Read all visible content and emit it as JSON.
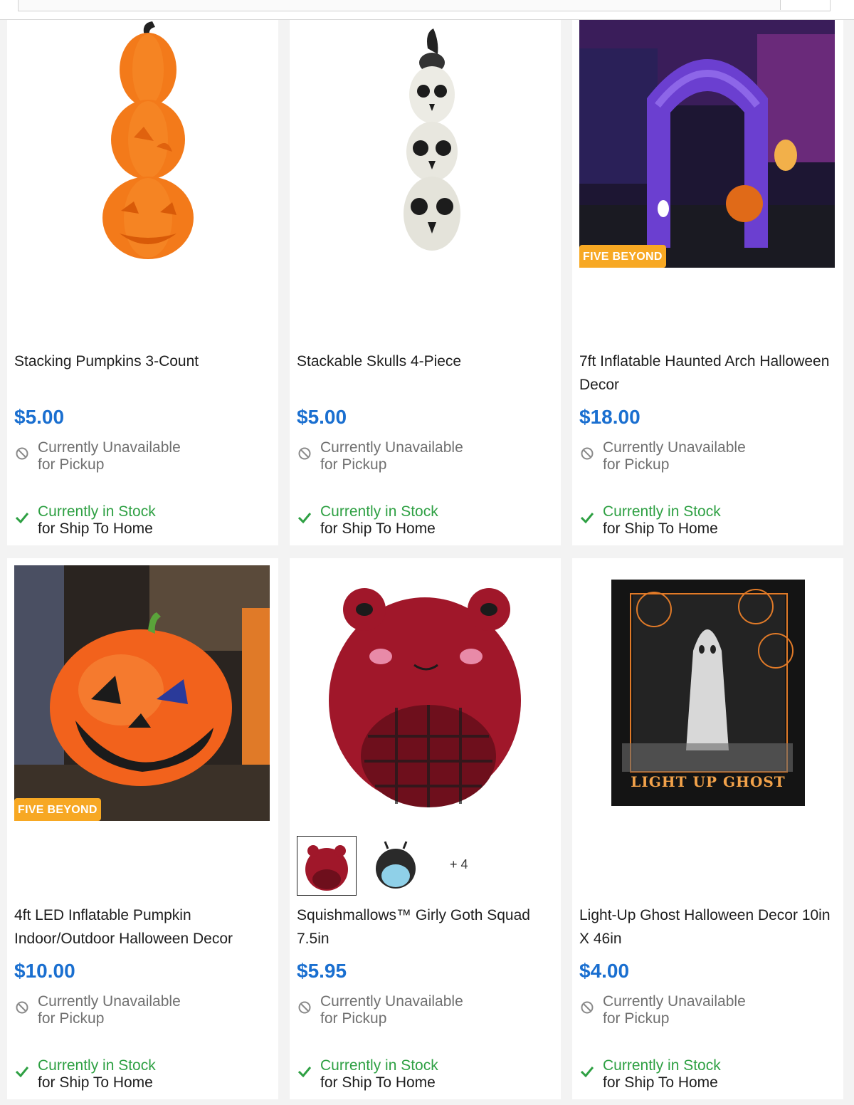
{
  "colors": {
    "price": "#1a6fd0",
    "in_stock": "#2ea043",
    "badge": "#f7a823",
    "muted": "#707070"
  },
  "icons": {
    "unavailable": "no-entry-icon",
    "available": "checkmark-icon"
  },
  "products": [
    {
      "title": "Stacking Pumpkins 3-Count",
      "price": "$5.00",
      "pickup_line1": "Currently Unavailable",
      "pickup_line2": "for Pickup",
      "ship_line1": "Currently in Stock",
      "ship_line2": "for Ship To Home"
    },
    {
      "title": "Stackable Skulls 4-Piece",
      "price": "$5.00",
      "pickup_line1": "Currently Unavailable",
      "pickup_line2": "for Pickup",
      "ship_line1": "Currently in Stock",
      "ship_line2": "for Ship To Home"
    },
    {
      "title": "7ft Inflatable Haunted Arch Halloween Decor",
      "badge": "FIVE BEYOND",
      "price": "$18.00",
      "pickup_line1": "Currently Unavailable",
      "pickup_line2": "for Pickup",
      "ship_line1": "Currently in Stock",
      "ship_line2": "for Ship To Home"
    },
    {
      "title": "4ft LED Inflatable Pumpkin Indoor/Outdoor Halloween Decor",
      "badge": "FIVE BEYOND",
      "price": "$10.00",
      "pickup_line1": "Currently Unavailable",
      "pickup_line2": "for Pickup",
      "ship_line1": "Currently in Stock",
      "ship_line2": "for Ship To Home"
    },
    {
      "title": "Squishmallows™ Girly Goth Squad 7.5in",
      "more_swatches": "+ 4",
      "price": "$5.95",
      "pickup_line1": "Currently Unavailable",
      "pickup_line2": "for Pickup",
      "ship_line1": "Currently in Stock",
      "ship_line2": "for Ship To Home"
    },
    {
      "title": "Light-Up Ghost Halloween Decor 10in X 46in",
      "box_text": "LIGHT UP GHOST",
      "price": "$4.00",
      "pickup_line1": "Currently Unavailable",
      "pickup_line2": "for Pickup",
      "ship_line1": "Currently in Stock",
      "ship_line2": "for Ship To Home"
    }
  ]
}
